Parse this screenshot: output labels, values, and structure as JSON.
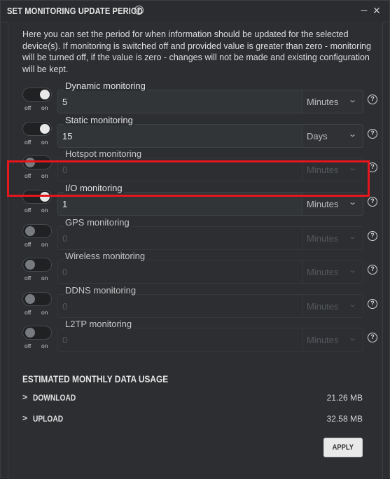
{
  "dialog": {
    "title": "SET MONITORING UPDATE PERIOD",
    "help_icon": "question-circle-icon",
    "minimize_glyph": "–",
    "close_glyph": "×"
  },
  "description": "Here you can set the period for when information should be updated for the selected device(s). If monitoring is switched off and provided value is greater than zero - monitoring will be turned off, if the value is zero - changes will not be made and existing configuration will be kept.",
  "toggle_labels": {
    "off": "off",
    "on": "on"
  },
  "monitors": [
    {
      "name": "Dynamic monitoring",
      "enabled": true,
      "value": "5",
      "unit": "Minutes"
    },
    {
      "name": "Static monitoring",
      "enabled": true,
      "value": "15",
      "unit": "Days"
    },
    {
      "name": "Hotspot monitoring",
      "enabled": false,
      "value": "0",
      "unit": "Minutes"
    },
    {
      "name": "I/O monitoring",
      "enabled": true,
      "value": "1",
      "unit": "Minutes",
      "highlighted": true
    },
    {
      "name": "GPS monitoring",
      "enabled": false,
      "value": "0",
      "unit": "Minutes"
    },
    {
      "name": "Wireless monitoring",
      "enabled": false,
      "value": "0",
      "unit": "Minutes"
    },
    {
      "name": "DDNS monitoring",
      "enabled": false,
      "value": "0",
      "unit": "Minutes"
    },
    {
      "name": "L2TP monitoring",
      "enabled": false,
      "value": "0",
      "unit": "Minutes"
    }
  ],
  "usage": {
    "title": "ESTIMATED MONTHLY DATA USAGE",
    "download": {
      "label": "DOWNLOAD",
      "amount": "21.26 MB"
    },
    "upload": {
      "label": "UPLOAD",
      "amount": "32.58 MB"
    }
  },
  "apply_label": "APPLY",
  "colors": {
    "highlight": "#e6161d",
    "background": "#2c2e31"
  }
}
